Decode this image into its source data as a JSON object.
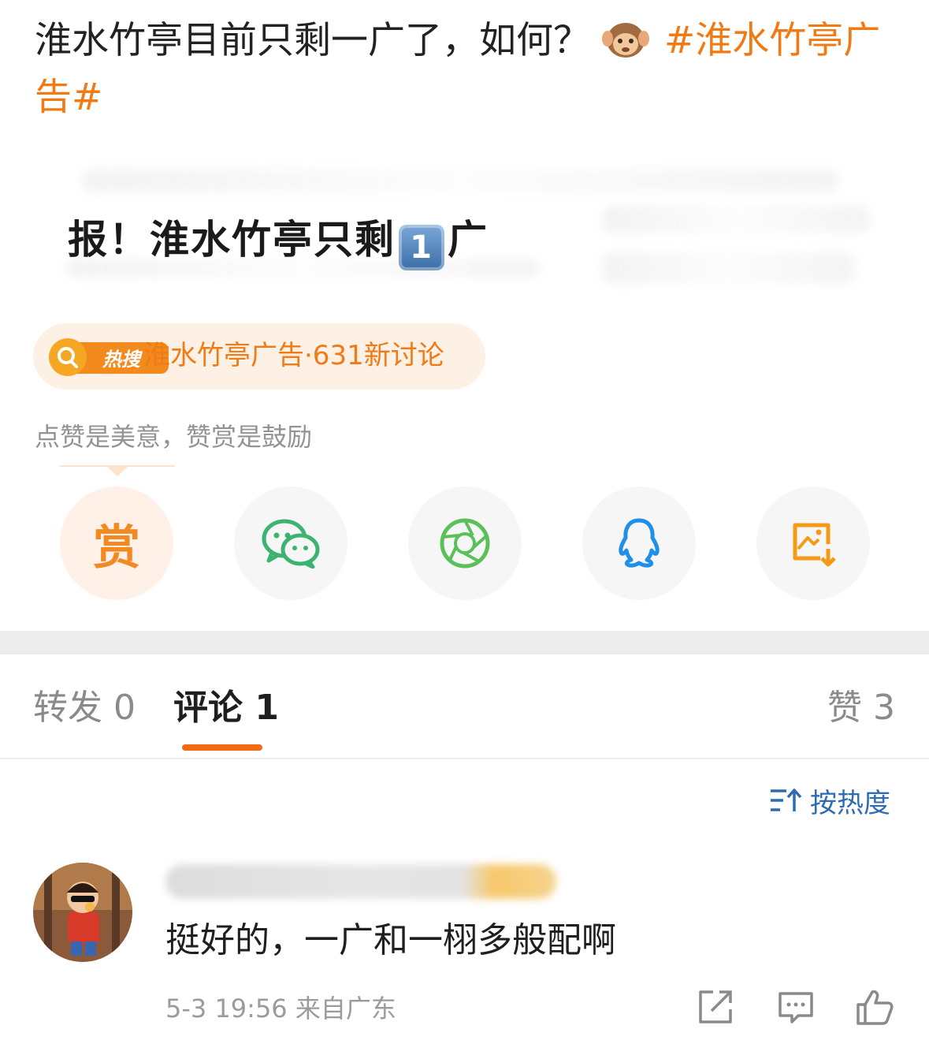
{
  "post": {
    "text": "淮水竹亭目前只剩一广了，如何？",
    "emoji": "see-no-evil-monkey",
    "hashtag": "#淮水竹亭广告#"
  },
  "card": {
    "headline_prefix": "报！淮水竹亭只剩",
    "keycap_digit": "1",
    "headline_suffix": "广"
  },
  "hot_search": {
    "badge_label": "热搜",
    "text": "淮水竹亭广告·631新讨论"
  },
  "reward_tip": "点赞是美意，赞赏是鼓励",
  "share_buttons": [
    {
      "name": "reward",
      "label": "赏",
      "icon": "reward-icon"
    },
    {
      "name": "wechat",
      "icon": "wechat-icon"
    },
    {
      "name": "moments",
      "icon": "wechat-moments-icon"
    },
    {
      "name": "qq",
      "icon": "qq-icon"
    },
    {
      "name": "save-image",
      "icon": "save-image-icon"
    }
  ],
  "tabs": {
    "repost": "转发 0",
    "comments": "评论 1",
    "likes": "赞 3"
  },
  "sort": {
    "label": "按热度",
    "icon": "sort-icon"
  },
  "comment": {
    "text": "挺好的，一广和一栩多般配啊",
    "time": "5-3 19:56",
    "source": "来自广东"
  },
  "colors": {
    "accent": "#f07a14",
    "link_blue": "#2d6bb3",
    "muted": "#939393"
  }
}
